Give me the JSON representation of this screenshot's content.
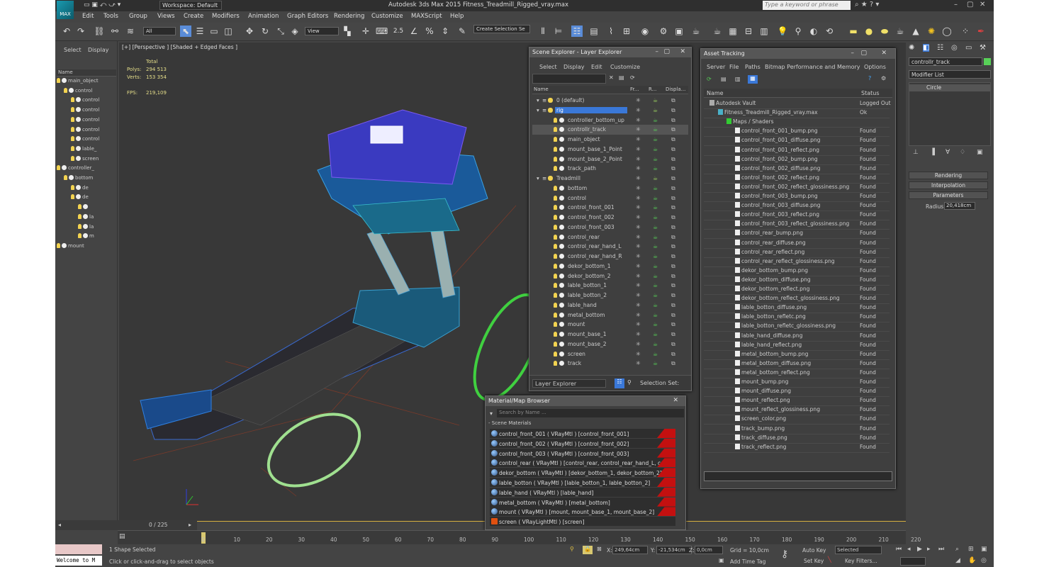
{
  "app": {
    "logo": "MAX",
    "workspace": "Workspace: Default",
    "title": "Autodesk 3ds Max 2015     Fitness_Treadmill_Rigged_vray.max",
    "search_placeholder": "Type a keyword or phrase"
  },
  "menu": [
    "Edit",
    "Tools",
    "Group",
    "Views",
    "Create",
    "Modifiers",
    "Animation",
    "Graph Editors",
    "Rendering",
    "Customize",
    "MAXScript",
    "Help"
  ],
  "toolbar": {
    "filter": "All",
    "view": "View",
    "selection_set": "Create Selection Se"
  },
  "left_panel": {
    "tabs": [
      "Select",
      "Display"
    ],
    "header": "Name",
    "rows": [
      {
        "label": "main_object",
        "indent": 0,
        "icon": "bulb"
      },
      {
        "label": "control",
        "indent": 1,
        "icon": "bulb"
      },
      {
        "label": "control",
        "indent": 2,
        "icon": "bulb"
      },
      {
        "label": "control",
        "indent": 2,
        "icon": "bulb"
      },
      {
        "label": "control",
        "indent": 2,
        "icon": "bulb"
      },
      {
        "label": "control",
        "indent": 2,
        "icon": "bulb"
      },
      {
        "label": "control",
        "indent": 2,
        "icon": "bulb"
      },
      {
        "label": "lable_",
        "indent": 2,
        "icon": "bulb"
      },
      {
        "label": "screen",
        "indent": 2,
        "icon": "bulb"
      },
      {
        "label": "controller_",
        "indent": 0,
        "icon": "bulb"
      },
      {
        "label": "bottom",
        "indent": 1,
        "icon": "bulb"
      },
      {
        "label": "de",
        "indent": 2,
        "icon": "bulb"
      },
      {
        "label": "de",
        "indent": 2,
        "icon": "bulb"
      },
      {
        "label": "",
        "indent": 3,
        "icon": "bulb"
      },
      {
        "label": "la",
        "indent": 3,
        "icon": "bulb"
      },
      {
        "label": "la",
        "indent": 3,
        "icon": "bulb"
      },
      {
        "label": "m",
        "indent": 3,
        "icon": "bulb"
      },
      {
        "label": "mount",
        "indent": 0,
        "icon": "bulb"
      }
    ]
  },
  "viewport": {
    "label": "[+] [Perspective ] [Shaded + Edged Faces ]",
    "stats": {
      "total_label": "Total",
      "polys_label": "Polys:",
      "polys": "294 513",
      "verts_label": "Verts:",
      "verts": "153 354",
      "fps_label": "FPS:",
      "fps": "219,109"
    }
  },
  "scene_explorer": {
    "title": "Scene Explorer - Layer Explorer",
    "menu": [
      "Select",
      "Display",
      "Edit",
      "Customize"
    ],
    "columns": [
      "Name",
      "Fr...",
      "R...",
      "Displa..."
    ],
    "rows": [
      {
        "label": "0 (default)",
        "indent": 0,
        "type": "layer"
      },
      {
        "label": "rig",
        "indent": 0,
        "type": "layer",
        "selected": true
      },
      {
        "label": "controller_bottom_up",
        "indent": 1,
        "type": "obj"
      },
      {
        "label": "controllr_track",
        "indent": 1,
        "type": "obj",
        "highlight": true
      },
      {
        "label": "main_object",
        "indent": 1,
        "type": "obj"
      },
      {
        "label": "mount_base_1_Point",
        "indent": 1,
        "type": "obj"
      },
      {
        "label": "mount_base_2_Point",
        "indent": 1,
        "type": "obj"
      },
      {
        "label": "track_path",
        "indent": 1,
        "type": "obj"
      },
      {
        "label": "Treadmill",
        "indent": 0,
        "type": "layer"
      },
      {
        "label": "bottom",
        "indent": 1,
        "type": "obj"
      },
      {
        "label": "control",
        "indent": 1,
        "type": "obj"
      },
      {
        "label": "control_front_001",
        "indent": 1,
        "type": "obj"
      },
      {
        "label": "control_front_002",
        "indent": 1,
        "type": "obj"
      },
      {
        "label": "control_front_003",
        "indent": 1,
        "type": "obj"
      },
      {
        "label": "control_rear",
        "indent": 1,
        "type": "obj"
      },
      {
        "label": "control_rear_hand_L",
        "indent": 1,
        "type": "obj"
      },
      {
        "label": "control_rear_hand_R",
        "indent": 1,
        "type": "obj"
      },
      {
        "label": "dekor_bottom_1",
        "indent": 1,
        "type": "obj"
      },
      {
        "label": "dekor_bottom_2",
        "indent": 1,
        "type": "obj"
      },
      {
        "label": "lable_botton_1",
        "indent": 1,
        "type": "obj"
      },
      {
        "label": "lable_botton_2",
        "indent": 1,
        "type": "obj"
      },
      {
        "label": "lable_hand",
        "indent": 1,
        "type": "obj"
      },
      {
        "label": "metal_bottom",
        "indent": 1,
        "type": "obj"
      },
      {
        "label": "mount",
        "indent": 1,
        "type": "obj"
      },
      {
        "label": "mount_base_1",
        "indent": 1,
        "type": "obj"
      },
      {
        "label": "mount_base_2",
        "indent": 1,
        "type": "obj"
      },
      {
        "label": "screen",
        "indent": 1,
        "type": "obj"
      },
      {
        "label": "track",
        "indent": 1,
        "type": "obj"
      }
    ],
    "footer": {
      "explorer": "Layer Explorer",
      "selection_set": "Selection Set:"
    }
  },
  "asset_tracking": {
    "title": "Asset Tracking",
    "menu": [
      "Server",
      "File",
      "Paths",
      "Bitmap Performance and Memory",
      "Options"
    ],
    "columns": [
      "Name",
      "Status"
    ],
    "rows": [
      {
        "name": "Autodesk Vault",
        "status": "Logged Out",
        "indent": 0
      },
      {
        "name": "Fitness_Treadmill_Rigged_vray.max",
        "status": "Ok",
        "indent": 1
      },
      {
        "name": "Maps / Shaders",
        "status": "",
        "indent": 2
      },
      {
        "name": "control_front_001_bump.png",
        "status": "Found",
        "indent": 3
      },
      {
        "name": "control_front_001_diffuse.png",
        "status": "Found",
        "indent": 3
      },
      {
        "name": "control_front_001_reflect.png",
        "status": "Found",
        "indent": 3
      },
      {
        "name": "control_front_002_bump.png",
        "status": "Found",
        "indent": 3
      },
      {
        "name": "control_front_002_diffuse.png",
        "status": "Found",
        "indent": 3
      },
      {
        "name": "control_front_002_reflect.png",
        "status": "Found",
        "indent": 3
      },
      {
        "name": "control_front_002_reflect_glossiness.png",
        "status": "Found",
        "indent": 3
      },
      {
        "name": "control_front_003_bump.png",
        "status": "Found",
        "indent": 3
      },
      {
        "name": "control_front_003_diffuse.png",
        "status": "Found",
        "indent": 3
      },
      {
        "name": "control_front_003_reflect.png",
        "status": "Found",
        "indent": 3
      },
      {
        "name": "control_front_003_reflect_glossiness.png",
        "status": "Found",
        "indent": 3
      },
      {
        "name": "control_rear_bump.png",
        "status": "Found",
        "indent": 3
      },
      {
        "name": "control_rear_diffuse.png",
        "status": "Found",
        "indent": 3
      },
      {
        "name": "control_rear_reflect.png",
        "status": "Found",
        "indent": 3
      },
      {
        "name": "control_rear_reflect_glossiness.png",
        "status": "Found",
        "indent": 3
      },
      {
        "name": "dekor_bottom_bump.png",
        "status": "Found",
        "indent": 3
      },
      {
        "name": "dekor_bottom_diffuse.png",
        "status": "Found",
        "indent": 3
      },
      {
        "name": "dekor_bottom_reflect.png",
        "status": "Found",
        "indent": 3
      },
      {
        "name": "dekor_bottom_reflect_glossiness.png",
        "status": "Found",
        "indent": 3
      },
      {
        "name": "lable_botton_diffuse.png",
        "status": "Found",
        "indent": 3
      },
      {
        "name": "lable_botton_refletc.png",
        "status": "Found",
        "indent": 3
      },
      {
        "name": "lable_botton_refletc_glossiness.png",
        "status": "Found",
        "indent": 3
      },
      {
        "name": "lable_hand_diffuse.png",
        "status": "Found",
        "indent": 3
      },
      {
        "name": "lable_hand_reflect.png",
        "status": "Found",
        "indent": 3
      },
      {
        "name": "metal_bottom_bump.png",
        "status": "Found",
        "indent": 3
      },
      {
        "name": "metal_bottom_diffuse.png",
        "status": "Found",
        "indent": 3
      },
      {
        "name": "metal_bottom_reflect.png",
        "status": "Found",
        "indent": 3
      },
      {
        "name": "mount_bump.png",
        "status": "Found",
        "indent": 3
      },
      {
        "name": "mount_diffuse.png",
        "status": "Found",
        "indent": 3
      },
      {
        "name": "mount_reflect.png",
        "status": "Found",
        "indent": 3
      },
      {
        "name": "mount_reflect_glossiness.png",
        "status": "Found",
        "indent": 3
      },
      {
        "name": "screen_color.png",
        "status": "Found",
        "indent": 3
      },
      {
        "name": "track_bump.png",
        "status": "Found",
        "indent": 3
      },
      {
        "name": "track_diffuse.png",
        "status": "Found",
        "indent": 3
      },
      {
        "name": "track_reflect.png",
        "status": "Found",
        "indent": 3
      }
    ]
  },
  "material_browser": {
    "title": "Material/Map Browser",
    "search_placeholder": "Search by Name ...",
    "section": "- Scene Materials",
    "rows": [
      "control_front_001  ( VRayMtl )  [control_front_001]",
      "control_front_002  ( VRayMtl )  [control_front_002]",
      "control_front_003  ( VRayMtl )  [control_front_003]",
      "control_rear  ( VRayMtl )  [control_rear, control_rear_hand_L, contr...",
      "dekor_bottom  ( VRayMtl )  [dekor_bottom_1, dekor_bottom_2]",
      "lable_botton  ( VRayMtl )  [lable_botton_1, lable_botton_2]",
      "lable_hand  ( VRayMtl )  [lable_hand]",
      "metal_bottom  ( VRayMtl )  [metal_bottom]",
      "mount  ( VRayMtl )  [mount, mount_base_1, mount_base_2]",
      "screen  ( VRayLightMtl )  [screen]"
    ]
  },
  "command_panel": {
    "object_name": "controllr_track",
    "modifier_list": "Modifier List",
    "stack_item": "Circle",
    "rollouts": [
      "Rendering",
      "Interpolation",
      "Parameters"
    ],
    "radius_label": "Radius:",
    "radius_value": "20,418cm"
  },
  "timeline": {
    "frame": "0 / 225",
    "ticks": [
      "0",
      "10",
      "20",
      "30",
      "40",
      "50",
      "60",
      "70",
      "80",
      "90",
      "100",
      "110",
      "120",
      "130",
      "140",
      "150",
      "160",
      "170",
      "180",
      "190",
      "200",
      "210",
      "220"
    ]
  },
  "status": {
    "welcome": "Welcome to M",
    "selected": "1 Shape Selected",
    "prompt": "Click or click-and-drag to select objects",
    "x_label": "X:",
    "x": "249,64cm",
    "y_label": "Y:",
    "y": "-21,534cm",
    "z_label": "Z:",
    "z": "0,0cm",
    "grid": "Grid = 10,0cm",
    "add_time_tag": "Add Time Tag",
    "auto_key": "Auto Key",
    "set_key": "Set Key",
    "key_mode": "Selected",
    "key_filters": "Key Filters..."
  }
}
